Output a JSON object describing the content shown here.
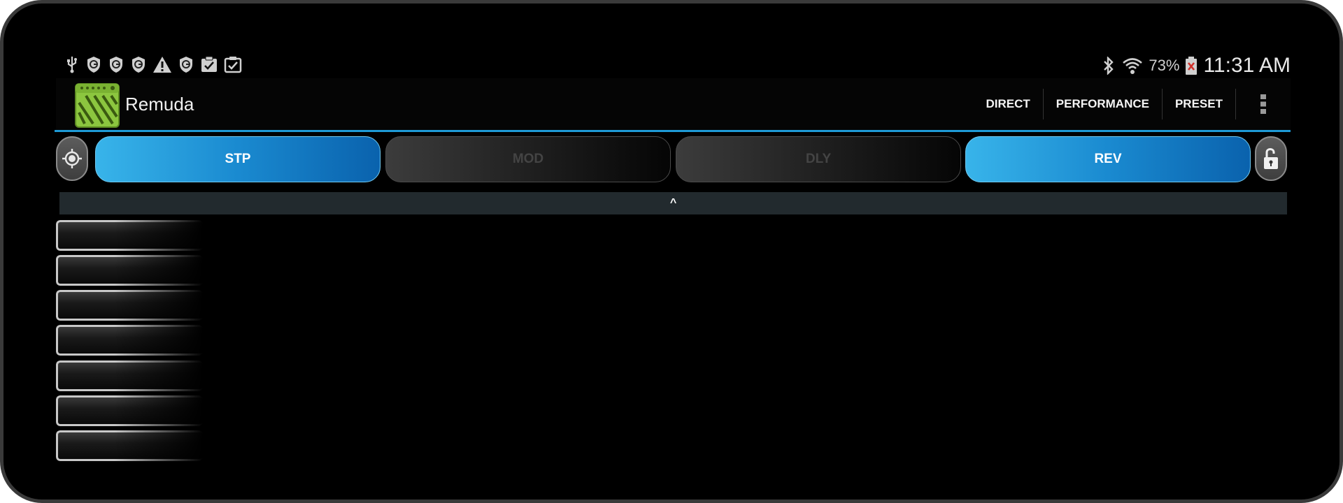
{
  "status_bar": {
    "left_icons": [
      "usb-icon",
      "shield-g-icon",
      "shield-g-icon",
      "shield-g-icon",
      "warning-icon",
      "shield-g-icon",
      "clipboard-check-icon",
      "clipboard-check-icon"
    ],
    "right_icons": [
      "bluetooth-icon",
      "wifi-icon",
      "battery-icon"
    ],
    "battery_text": "73%",
    "time": "11:31 AM"
  },
  "app": {
    "title": "Remuda",
    "logo_color": "#8cc63f",
    "accent": "#1e9ad6"
  },
  "actions": [
    {
      "label": "DIRECT"
    },
    {
      "label": "PERFORMANCE"
    },
    {
      "label": "PRESET"
    }
  ],
  "effects": [
    {
      "label": "STP",
      "state": "on"
    },
    {
      "label": "MOD",
      "state": "off"
    },
    {
      "label": "DLY",
      "state": "off"
    },
    {
      "label": "REV",
      "state": "on"
    }
  ],
  "collapse_toggle": "^"
}
